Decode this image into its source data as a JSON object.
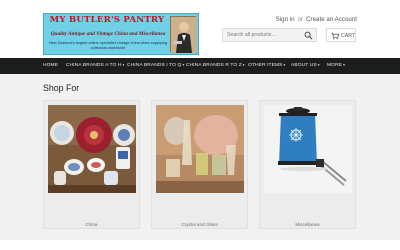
{
  "logo": {
    "title": "MY BUTLER'S PANTRY",
    "tagline": "Quality Antique and Vintage China and Miscellanea",
    "subtitle": "New Zealand's largest online specialist vintage china store supplying collectors worldwide"
  },
  "account": {
    "sign_in": "Sign in",
    "or": "or",
    "create": "Create an Account"
  },
  "search": {
    "placeholder": "Search all products..."
  },
  "cart": {
    "label": "CART"
  },
  "nav": {
    "items": [
      {
        "label": "HOME",
        "has_dropdown": false
      },
      {
        "label": "CHINA BRANDS A TO H",
        "has_dropdown": true
      },
      {
        "label": "CHINA BRANDS I TO Q",
        "has_dropdown": true
      },
      {
        "label": "CHINA BRANDS R TO Z",
        "has_dropdown": true
      },
      {
        "label": "OTHER ITEMS",
        "has_dropdown": true
      },
      {
        "label": "ABOUT US",
        "has_dropdown": true
      },
      {
        "label": "MORE",
        "has_dropdown": true
      }
    ]
  },
  "shop_for": {
    "title": "Shop For",
    "cards": [
      {
        "label": "China"
      },
      {
        "label": "Crystal and Glass"
      },
      {
        "label": "Miscellanea"
      }
    ]
  },
  "colors": {
    "nav_bg": "#1c1d1d",
    "logo_bg": "#6fd0e8",
    "logo_title": "#b81c1c",
    "page_bg": "#f1f1f1"
  }
}
